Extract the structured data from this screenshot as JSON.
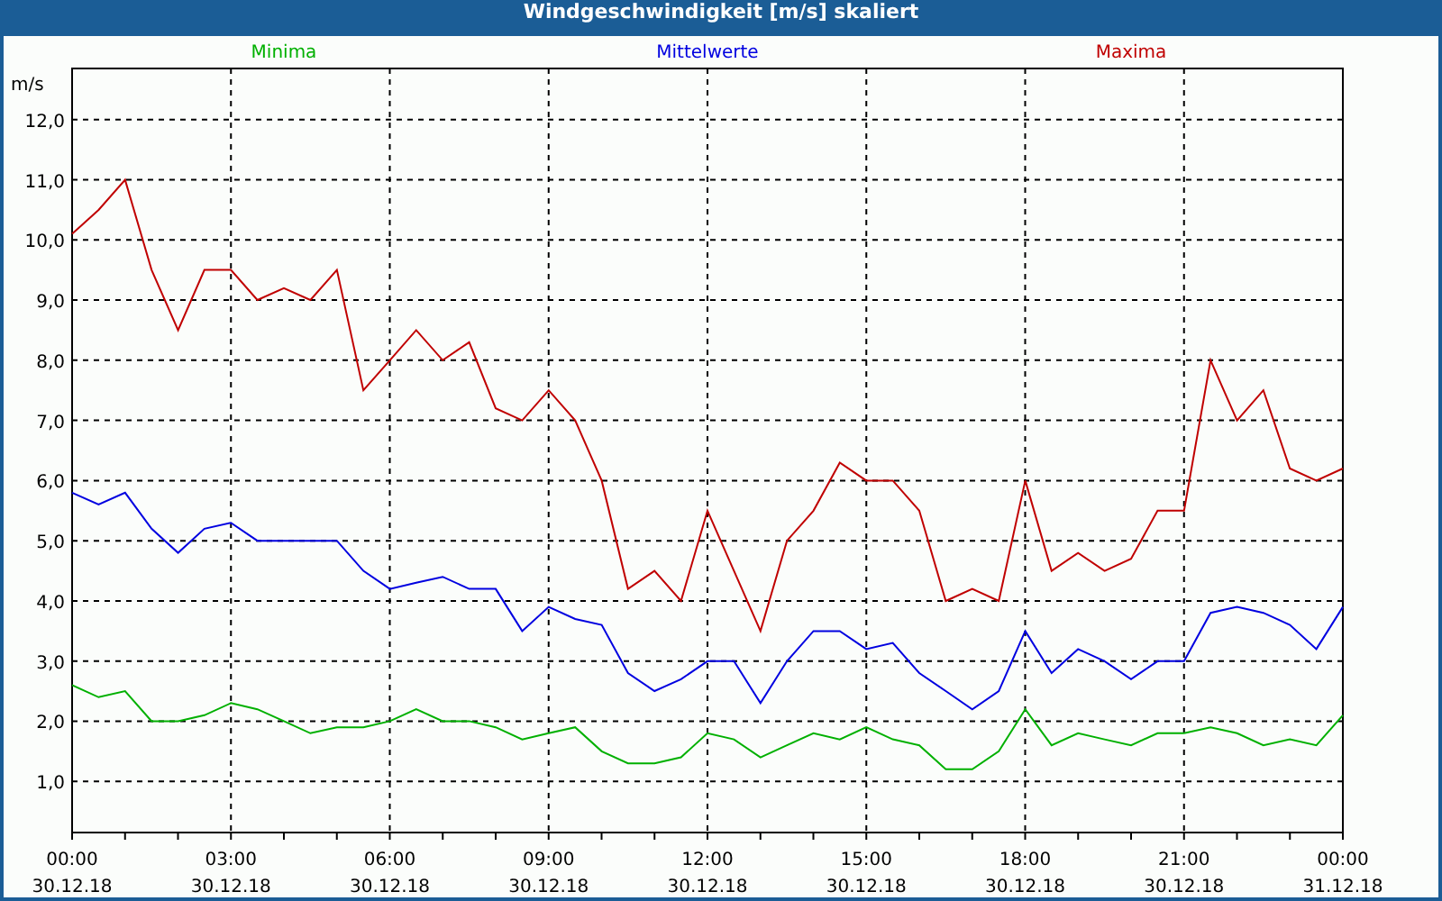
{
  "window": {
    "title": "Windgeschwindigkeit [m/s] skaliert"
  },
  "chart": {
    "chart_data": {
      "type": "line",
      "grid": true,
      "ylabel": "m/s",
      "ylim": [
        0.15,
        12.85
      ],
      "categories": [
        "00:00\n30.12.18",
        null,
        null,
        null,
        null,
        null,
        "03:00\n30.12.18",
        null,
        null,
        null,
        null,
        null,
        "06:00\n30.12.18",
        null,
        null,
        null,
        null,
        null,
        "09:00\n30.12.18",
        null,
        null,
        null,
        null,
        null,
        "12:00\n30.12.18",
        null,
        null,
        null,
        null,
        null,
        "15:00\n30.12.18",
        null,
        null,
        null,
        null,
        null,
        "18:00\n30.12.18",
        null,
        null,
        null,
        null,
        null,
        "21:00\n30.12.18",
        null,
        null,
        null,
        null,
        null,
        "00:00\n31.12.18"
      ],
      "yticks": [
        {
          "value": 1,
          "label": "1,0"
        },
        {
          "value": 2,
          "label": "2,0"
        },
        {
          "value": 3,
          "label": "3,0"
        },
        {
          "value": 4,
          "label": "4,0"
        },
        {
          "value": 5,
          "label": "5,0"
        },
        {
          "value": 6,
          "label": "6,0"
        },
        {
          "value": 7,
          "label": "7,0"
        },
        {
          "value": 8,
          "label": "8,0"
        },
        {
          "value": 9,
          "label": "9,0"
        },
        {
          "value": 10,
          "label": "10,0"
        },
        {
          "value": 11,
          "label": "11,0"
        },
        {
          "value": 12,
          "label": "12,0"
        }
      ],
      "series": [
        {
          "name": "Minima",
          "color": "#00b000",
          "values": [
            2.6,
            2.4,
            2.5,
            2.0,
            2.0,
            2.1,
            2.3,
            2.2,
            2.0,
            1.8,
            1.9,
            1.9,
            2.0,
            2.2,
            2.0,
            2.0,
            1.9,
            1.7,
            1.8,
            1.9,
            1.5,
            1.3,
            1.3,
            1.4,
            1.8,
            1.7,
            1.4,
            1.6,
            1.8,
            1.7,
            1.9,
            1.7,
            1.6,
            1.2,
            1.2,
            1.5,
            2.2,
            1.6,
            1.8,
            1.7,
            1.6,
            1.8,
            1.8,
            1.9,
            1.8,
            1.6,
            1.7,
            1.6,
            2.1
          ]
        },
        {
          "name": "Mittelwerte",
          "color": "#0000e0",
          "values": [
            5.8,
            5.6,
            5.8,
            5.2,
            4.8,
            5.2,
            5.3,
            5.0,
            5.0,
            5.0,
            5.0,
            4.5,
            4.2,
            4.3,
            4.4,
            4.2,
            4.2,
            3.5,
            3.9,
            3.7,
            3.6,
            2.8,
            2.5,
            2.7,
            3.0,
            3.0,
            2.3,
            3.0,
            3.5,
            3.5,
            3.2,
            3.3,
            2.8,
            2.5,
            2.2,
            2.5,
            3.5,
            2.8,
            3.2,
            3.0,
            2.7,
            3.0,
            3.0,
            3.8,
            3.9,
            3.8,
            3.6,
            3.2,
            3.9
          ]
        },
        {
          "name": "Maxima",
          "color": "#c00000",
          "values": [
            10.1,
            10.5,
            11.0,
            9.5,
            8.5,
            9.5,
            9.5,
            9.0,
            9.2,
            9.0,
            9.5,
            7.5,
            8.0,
            8.5,
            8.0,
            8.3,
            7.2,
            7.0,
            7.5,
            7.0,
            6.0,
            4.2,
            4.5,
            4.0,
            5.5,
            4.5,
            3.5,
            5.0,
            5.5,
            6.3,
            6.0,
            6.0,
            5.5,
            4.0,
            4.2,
            4.0,
            6.0,
            4.5,
            4.8,
            4.5,
            4.7,
            5.5,
            5.5,
            8.0,
            7.0,
            7.5,
            6.2,
            6.0,
            6.2
          ]
        }
      ]
    }
  }
}
